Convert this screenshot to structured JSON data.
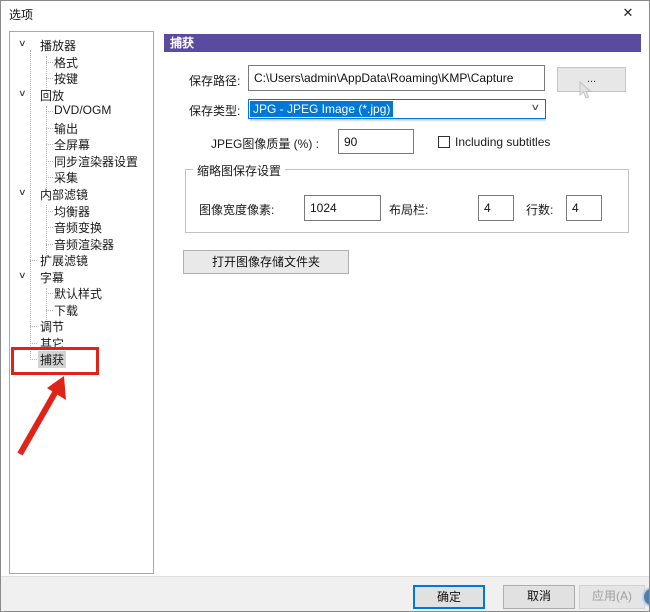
{
  "window": {
    "title": "选项",
    "close_glyph": "✕"
  },
  "icons": {
    "chevron": "∨"
  },
  "sidebar": {
    "items": [
      {
        "label": "播放器",
        "type": "parent",
        "selected": false
      },
      {
        "label": "格式",
        "type": "child",
        "selected": false
      },
      {
        "label": "按键",
        "type": "child",
        "selected": false
      },
      {
        "label": "回放",
        "type": "parent",
        "selected": false
      },
      {
        "label": "DVD/OGM",
        "type": "child",
        "selected": false
      },
      {
        "label": "输出",
        "type": "child",
        "selected": false
      },
      {
        "label": "全屏幕",
        "type": "child",
        "selected": false
      },
      {
        "label": "同步渲染器设置",
        "type": "child",
        "selected": false
      },
      {
        "label": "采集",
        "type": "child",
        "selected": false
      },
      {
        "label": "内部滤镜",
        "type": "parent",
        "selected": false
      },
      {
        "label": "均衡器",
        "type": "child",
        "selected": false
      },
      {
        "label": "音频变换",
        "type": "child",
        "selected": false
      },
      {
        "label": "音频渲染器",
        "type": "child",
        "selected": false
      },
      {
        "label": "扩展滤镜",
        "type": "root-leaf",
        "selected": false
      },
      {
        "label": "字幕",
        "type": "parent",
        "selected": false
      },
      {
        "label": "默认样式",
        "type": "child",
        "selected": false
      },
      {
        "label": "下载",
        "type": "child",
        "selected": false
      },
      {
        "label": "调节",
        "type": "root-leaf",
        "selected": false
      },
      {
        "label": "其它",
        "type": "root-leaf",
        "selected": false
      },
      {
        "label": "捕获",
        "type": "root-leaf",
        "selected": true
      }
    ]
  },
  "panel": {
    "header": "捕获",
    "save_path": {
      "label": "保存路径:",
      "value": "C:\\Users\\admin\\AppData\\Roaming\\KMP\\Capture",
      "browse_label": "..."
    },
    "save_type": {
      "label": "保存类型:",
      "value": "JPG - JPEG Image (*.jpg)"
    },
    "jpeg_quality": {
      "label": "JPEG图像质量 (%) :",
      "value": "90"
    },
    "subtitles": {
      "label": "Including subtitles",
      "checked": false
    },
    "thumb": {
      "title": "缩略图保存设置",
      "width_label": "图像宽度像素:",
      "width_value": "1024",
      "cols_label": "布局栏:",
      "cols_value": "4",
      "rows_label": "行数:",
      "rows_value": "4"
    },
    "open_folder_label": "打开图像存储文件夹"
  },
  "footer": {
    "ok": "确定",
    "cancel": "取消",
    "apply": "应用(A)"
  },
  "colors": {
    "accent_purple": "#5a4b9e",
    "selection_blue": "#0078d7",
    "annotation_red": "#df2318"
  }
}
